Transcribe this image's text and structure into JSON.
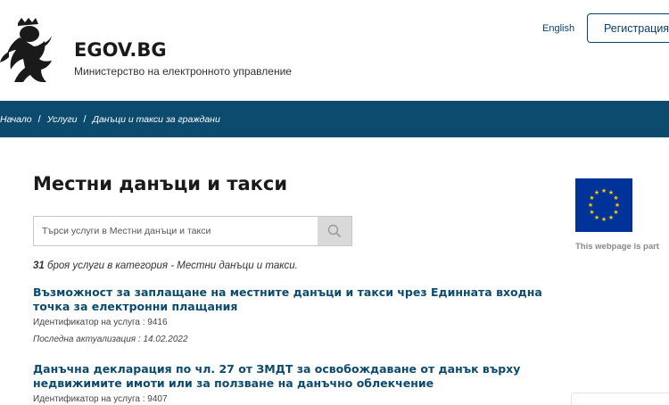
{
  "header": {
    "brand_title": "EGOV.BG",
    "brand_subtitle": "Министерство на електронното управление",
    "lang_link": "English",
    "register_label": "Регистрация"
  },
  "breadcrumb": {
    "items": [
      "Начало",
      "Услуги",
      "Данъци и такси за граждани"
    ],
    "separator": "/"
  },
  "main": {
    "title": "Местни данъци и такси",
    "search": {
      "placeholder": "Търси услуги в Местни данъци и такси",
      "value": ""
    },
    "count_number": "31",
    "count_text": " броя услуги в категория - Местни данъци и такси.",
    "services": [
      {
        "title": "Възможност за заплащане на местните данъци и такси чрез Единната входна точка за електронни плащания",
        "id_line": "Идентификатор на услуга : 9416",
        "date_line": "Последна актуализация : 14.02.2022"
      },
      {
        "title": "Данъчна декларация по чл. 27 от ЗМДТ за освобождаване от данък върху недвижимите имоти или за ползване на данъчно облекчение",
        "id_line": "Идентификатор на услуга : 9407"
      }
    ]
  },
  "sidebar": {
    "eu_caption": "This webpage is part"
  },
  "icons": {
    "logo": "lion-coat-of-arms-icon",
    "search": "search-icon",
    "flag": "eu-flag-icon"
  },
  "colors": {
    "brand_blue": "#0c4a6e",
    "eu_blue": "#003399",
    "eu_gold": "#ffcc00"
  }
}
